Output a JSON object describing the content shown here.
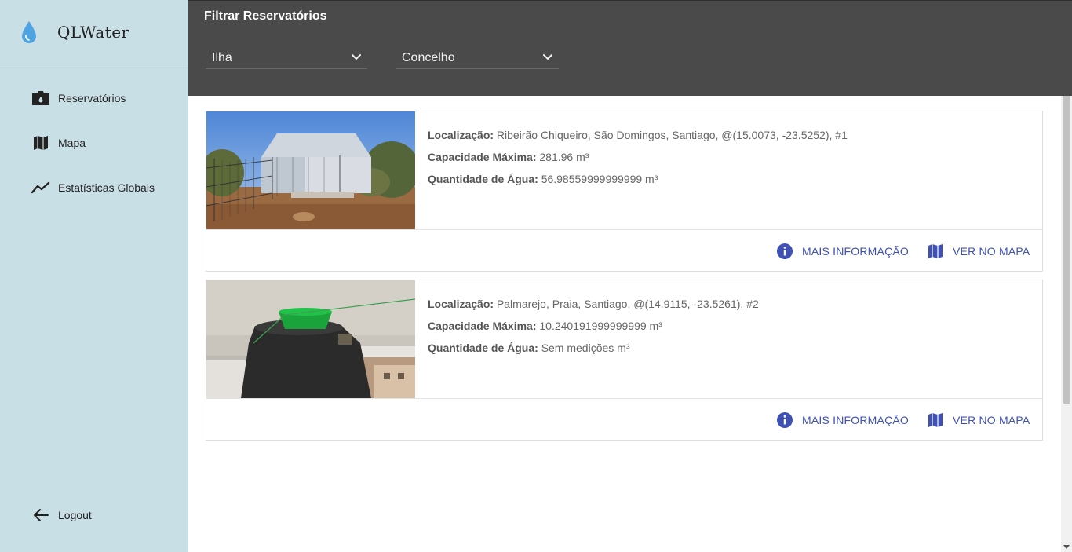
{
  "app": {
    "name": "QLWater"
  },
  "sidebar": {
    "items": [
      {
        "label": "Reservatórios",
        "icon": "water-tank-icon"
      },
      {
        "label": "Mapa",
        "icon": "map-icon"
      },
      {
        "label": "Estatísticas Globais",
        "icon": "trending-line-icon"
      }
    ],
    "logout": {
      "label": "Logout",
      "icon": "arrow-left-icon"
    }
  },
  "filter": {
    "title": "Filtrar Reservatórios",
    "island": "Ilha",
    "municipality": "Concelho"
  },
  "reservoirs": [
    {
      "location_label": "Localização:",
      "location": "Ribeirão Chiqueiro, São Domingos, Santiago, @(15.0073, -23.5252), #1",
      "capacity_label": "Capacidade Máxima:",
      "capacity": "281.96 m³",
      "water_label": "Quantidade de Água:",
      "water": "56.98559999999999 m³",
      "more_info": "MAIS INFORMAÇÃO",
      "view_map": "VER NO MAPA"
    },
    {
      "location_label": "Localização:",
      "location": "Palmarejo, Praia, Santiago, @(14.9115, -23.5261), #2",
      "capacity_label": "Capacidade Máxima:",
      "capacity": "10.240191999999999 m³",
      "water_label": "Quantidade de Água:",
      "water": "Sem medições m³",
      "more_info": "MAIS INFORMAÇÃO",
      "view_map": "VER NO MAPA"
    }
  ],
  "colors": {
    "sidebar_bg": "#c9dfe6",
    "header_bg": "#4a4a4a",
    "accent": "#3f51b5"
  }
}
